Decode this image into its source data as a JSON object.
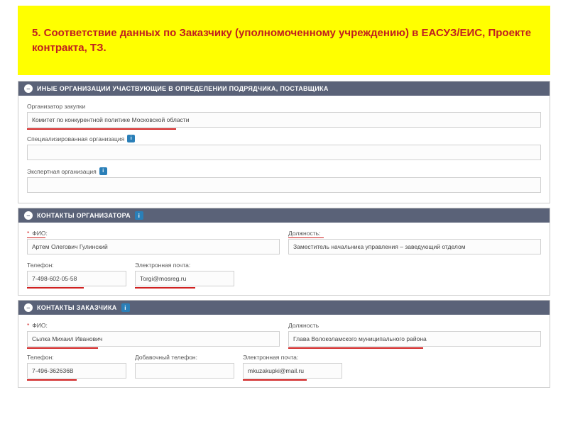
{
  "banner": {
    "title": "5. Соответствие данных по Заказчику (уполномоченному учреждению) в ЕАСУЗ/ЕИС, Проекте контракта, ТЗ."
  },
  "panel_other_orgs": {
    "header": "ИНЫЕ ОРГАНИЗАЦИИ УЧАСТВУЮЩИЕ В ОПРЕДЕЛЕНИИ ПОДРЯДЧИКА, ПОСТАВЩИКА",
    "organizer_label": "Организатор закупки",
    "organizer_value": "Комитет по конкурентной политике Московской области",
    "specialized_label": "Специализированная организация",
    "expert_label": "Экспертная организация"
  },
  "panel_organizer_contacts": {
    "header": "КОНТАКТЫ ОРГАНИЗАТОРА",
    "fio_label": "ФИО:",
    "fio_value": "Артем Олегович Гулинский",
    "position_label": "Должность:",
    "position_value": "Заместитель начальника управления – заведующий отделом",
    "phone_label": "Телефон:",
    "phone_value": "7-498-602-05-58",
    "email_label": "Электронная почта:",
    "email_value": "Torgi@mosreg.ru"
  },
  "panel_customer_contacts": {
    "header": "КОНТАКТЫ ЗАКАЗЧИКА",
    "fio_label": "ФИО:",
    "fio_value": "Сылка Михаил Иванович",
    "position_label": "Должность",
    "position_value": "Глава Волоколамского муниципального района",
    "phone_label": "Телефон:",
    "phone_value": "7-496-362636В",
    "addphone_label": "Добавочный телефон:",
    "email_label": "Электронная почта:",
    "email_value": "mkuzakupki@mail.ru"
  },
  "icons": {
    "collapse": "–",
    "info": "i",
    "star": "*"
  }
}
